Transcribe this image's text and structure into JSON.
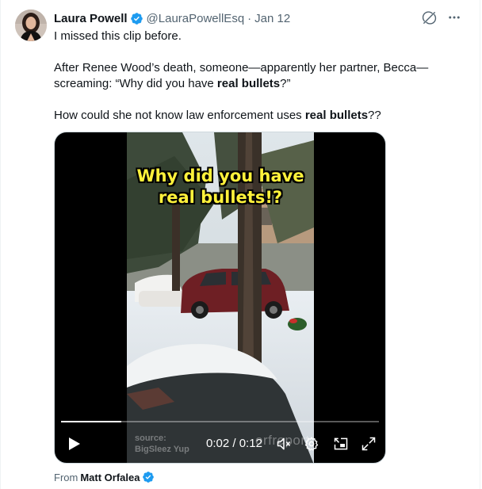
{
  "post": {
    "author_name": "Laura Powell",
    "handle": "@LauraPowellEsq",
    "separator": "·",
    "date": "Jan 12",
    "paragraph1": "I missed this clip before.",
    "paragraph2_part1": "After Renee Wood’s death, someone—apparently her partner, Becca—screaming: “Why did you have ",
    "paragraph2_bold": "real bullets",
    "paragraph2_part2": "?”",
    "paragraph3_part1": "How could she not know law enforcement uses ",
    "paragraph3_bold": "real bullets",
    "paragraph3_part2": "??"
  },
  "video": {
    "caption_line1": "Why did you have",
    "caption_line2": "real bullets!?",
    "source_label": "source:",
    "source_name": "BigSleez Yup",
    "watermark": "orfreport",
    "current_time": "0:02",
    "time_separator": " / ",
    "duration": "0:12",
    "progress_fraction": 0.19
  },
  "attribution": {
    "prefix": "From",
    "author": "Matt Orfalea"
  },
  "icons": {
    "verified": "verified-badge-icon",
    "grok": "grok-icon",
    "more": "more-icon",
    "play": "play-icon",
    "mute": "volume-muted-icon",
    "settings": "settings-gear-icon",
    "pip": "picture-in-picture-icon",
    "fullscreen": "fullscreen-icon"
  },
  "colors": {
    "verified_blue": "#1d9bf0",
    "secondary_text": "#536471",
    "caption_yellow": "#fff23b"
  }
}
